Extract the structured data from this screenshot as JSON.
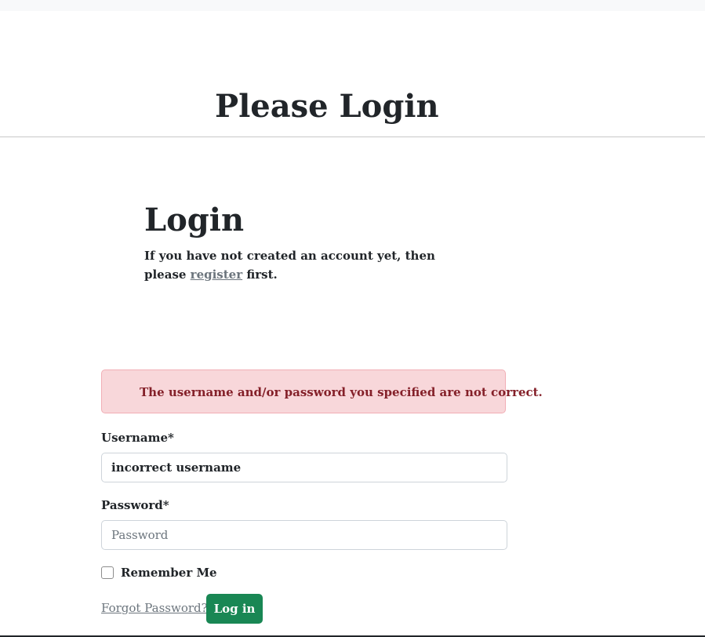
{
  "page": {
    "title": "Please Login"
  },
  "login": {
    "heading": "Login",
    "intro_before": "If you have not created an account yet, then please",
    "register_link": "register",
    "intro_after": "first."
  },
  "alert": {
    "message": "The username and/or password you specified are not correct."
  },
  "form": {
    "username_label": "Username*",
    "username_value": "incorrect username",
    "password_label": "Password*",
    "password_placeholder": "Password",
    "remember_label": "Remember Me",
    "remember_checked": false,
    "forgot_link": "Forgot Password?",
    "submit_label": "Log in"
  },
  "colors": {
    "alert_bg": "#f8d7da",
    "alert_text": "#842029",
    "button_bg": "#198754",
    "link": "#6c757d"
  }
}
